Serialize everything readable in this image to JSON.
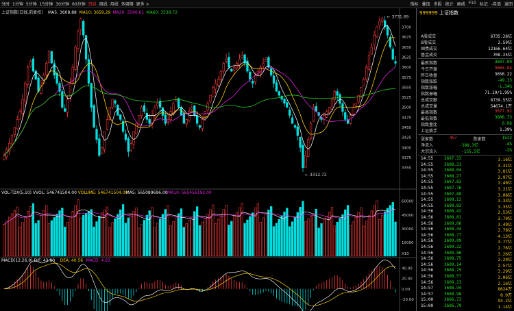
{
  "toolbar": {
    "periods": [
      "分时",
      "1分钟",
      "5分钟",
      "15分钟",
      "30分钟",
      "60分钟",
      "日线",
      "周线",
      "月线",
      "多周期",
      "更多 >"
    ],
    "active_period": 6,
    "right_items": [
      "指标",
      "叠加",
      "多股",
      "统计",
      "画线",
      "F10",
      "标记",
      "-自选",
      "返回"
    ]
  },
  "overlay": {
    "header": "上证指数(日线,前复权)",
    "ma_legend": [
      {
        "text": "MA5: 3608.88",
        "color": "#f0f0f0"
      },
      {
        "text": "MA10: 3659.29",
        "color": "#ffd000"
      },
      {
        "text": "MA20: 3590.61",
        "color": "#e020e0"
      },
      {
        "text": "MA60: 3538.72",
        "color": "#20d020"
      }
    ],
    "high_label": "3731.69",
    "low_label": "3312.72",
    "vol_legend": [
      {
        "text": "VOL-TDX(5,10)  VVOL: 546741504.00",
        "color": "#f0f0f0"
      },
      {
        "text": "VOLUME: 546741504.00",
        "color": "#ffd000"
      },
      {
        "text": "MA5: 565089696.00",
        "color": "#f0f0f0"
      },
      {
        "text": "MA10: 565456192.00",
        "color": "#e020e0"
      }
    ],
    "vol_unit": "X10",
    "macd_legend": [
      {
        "text": "MACD(12,26,9)",
        "color": "#f0f0f0"
      },
      {
        "text": "DIF: 42.80",
        "color": "#f0f0f0"
      },
      {
        "text": "DEA: 40.56",
        "color": "#ffd000"
      },
      {
        "text": "MACD: 4.63",
        "color": "#e020e0"
      }
    ],
    "price_axis": [
      "3700",
      "3675",
      "3650",
      "3625",
      "3600",
      "3575",
      "3550",
      "3525",
      "3500",
      "3475",
      "3450",
      "3425",
      "3400",
      "3375",
      "3350"
    ],
    "vol_axis": [
      "60000",
      "45000",
      "30000",
      "15000"
    ],
    "macd_axis": [
      "40.00",
      "20.00",
      "0.00",
      "-20.00"
    ]
  },
  "chart_data": {
    "type": "candlestick",
    "price_range": [
      3300,
      3740
    ],
    "high": 3731.69,
    "low": 3312.72,
    "closes": [
      3380,
      3395,
      3410,
      3430,
      3450,
      3470,
      3490,
      3520,
      3560,
      3600,
      3615,
      3590,
      3570,
      3540,
      3555,
      3580,
      3610,
      3640,
      3610,
      3580,
      3560,
      3540,
      3500,
      3490,
      3520,
      3560,
      3600,
      3650,
      3690,
      3720,
      3680,
      3620,
      3560,
      3500,
      3450,
      3420,
      3380,
      3400,
      3440,
      3470,
      3500,
      3520,
      3510,
      3480,
      3470,
      3440,
      3420,
      3390,
      3410,
      3440,
      3460,
      3480,
      3500,
      3490,
      3470,
      3460,
      3480,
      3500,
      3510,
      3500,
      3480,
      3460,
      3470,
      3490,
      3510,
      3520,
      3500,
      3480,
      3460,
      3470,
      3490,
      3500,
      3480,
      3460,
      3450,
      3470,
      3490,
      3510,
      3530,
      3550,
      3560,
      3570,
      3590,
      3610,
      3620,
      3600,
      3590,
      3600,
      3610,
      3620,
      3630,
      3610,
      3590,
      3570,
      3560,
      3580,
      3590,
      3600,
      3610,
      3620,
      3600,
      3580,
      3560,
      3540,
      3530,
      3520,
      3510,
      3500,
      3480,
      3460,
      3450,
      3430,
      3400,
      3350,
      3380,
      3420,
      3460,
      3500,
      3490,
      3480,
      3470,
      3480,
      3490,
      3500,
      3520,
      3540,
      3530,
      3510,
      3490,
      3470,
      3460,
      3480,
      3500,
      3510,
      3530,
      3550,
      3570,
      3600,
      3630,
      3650,
      3680,
      3700,
      3715,
      3720,
      3700,
      3680,
      3650,
      3620,
      3610
    ],
    "macd_range": [
      -40,
      50
    ]
  },
  "panel": {
    "code": "999999",
    "name": "上证指数",
    "rows": [
      {
        "label": "A股成交",
        "value": "6735.28亿",
        "cls": "white"
      },
      {
        "label": "B股成交",
        "value": "2.59亿",
        "cls": "white"
      },
      {
        "label": "国债成交",
        "value": "12166.64亿",
        "cls": "white"
      },
      {
        "label": "基金成交",
        "value": "708.25亿",
        "cls": "white"
      }
    ],
    "quote": [
      {
        "label": "最新指数",
        "value": "3607.09",
        "cls": "green"
      },
      {
        "label": "今日开盘",
        "value": "3664.84",
        "cls": "red"
      },
      {
        "label": "昨日收盘",
        "value": "3656.22",
        "cls": "white"
      },
      {
        "label": "指数涨跌",
        "value": "-49.13",
        "cls": "green"
      },
      {
        "label": "指数涨幅",
        "value": "-1.34%",
        "cls": "green"
      },
      {
        "label": "指数振幅",
        "value": "71.19/1.95%",
        "cls": "white"
      },
      {
        "label": "总成交额",
        "value": "6739.55亿",
        "cls": "white"
      },
      {
        "label": "总成交量",
        "value": "54674.1万",
        "cls": "white"
      },
      {
        "label": "最高指数",
        "value": "3677.92",
        "cls": "red"
      },
      {
        "label": "最低指数",
        "value": "3606.73",
        "cls": "green"
      },
      {
        "label": "指数量比",
        "value": "0.96",
        "cls": "green"
      },
      {
        "label": "上证换手",
        "value": "1.39%",
        "cls": "white"
      }
    ],
    "breadth": {
      "up_label": "涨家数",
      "up": "457",
      "down_label": "跌家数",
      "down": "1522"
    },
    "flows": [
      {
        "label": "净流入",
        "value": "-288.3亿",
        "pct": "-4%"
      },
      {
        "label": "大宗流入",
        "value": "-155.5亿",
        "pct": "-2%"
      }
    ],
    "ticks": [
      [
        "14:55",
        "3607.33",
        "3.16亿"
      ],
      [
        "14:55",
        "3608.21",
        "3.31亿"
      ],
      [
        "14:55",
        "3608.04",
        "3.81亿"
      ],
      [
        "14:55",
        "3608.27",
        "2.97亿"
      ],
      [
        "14:55",
        "3607.83",
        "3.40亿"
      ],
      [
        "14:55",
        "3607.76",
        "3.21亿"
      ],
      [
        "14:55",
        "3607.88",
        "3.08亿"
      ],
      [
        "14:55",
        "3608.12",
        "3.33亿"
      ],
      [
        "14:55",
        "3608.83",
        "3.35亿"
      ],
      [
        "14:56",
        "3608.42",
        "2.53亿"
      ],
      [
        "14:56",
        "3608.81",
        "3.70亿"
      ],
      [
        "14:56",
        "3609.06",
        "3.49亿"
      ],
      [
        "14:56",
        "3608.44",
        "2.78亿"
      ],
      [
        "14:56",
        "3608.77",
        "4.13亿"
      ],
      [
        "14:56",
        "3609.09",
        "3.77亿"
      ],
      [
        "14:56",
        "3609.22",
        "2.76亿"
      ],
      [
        "14:56",
        "3609.86",
        "3.26亿"
      ],
      [
        "14:56",
        "3608.75",
        "3.29亿"
      ],
      [
        "14:56",
        "3609.14",
        "2.57亿"
      ],
      [
        "14:56",
        "3608.75",
        "3.29亿"
      ],
      [
        "14:56",
        "3608.57",
        "3.06亿"
      ],
      [
        "14:56",
        "3609.23",
        "2.16亿"
      ],
      [
        "14:57",
        "3608.94",
        "8624万"
      ],
      [
        "14:57",
        "3608.98",
        "0.0万"
      ],
      [
        "15:00",
        "3606.73",
        "93.2亿"
      ],
      [
        "15:00",
        "3606.79",
        "1.14亿"
      ]
    ]
  }
}
